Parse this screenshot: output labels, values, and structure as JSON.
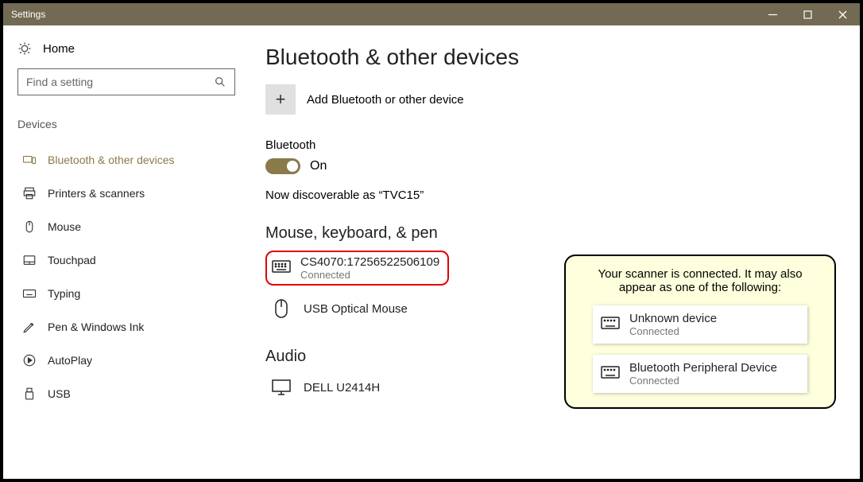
{
  "window_title": "Settings",
  "home_label": "Home",
  "search": {
    "placeholder": "Find a setting"
  },
  "category": "Devices",
  "nav": [
    {
      "label": "Bluetooth & other devices"
    },
    {
      "label": "Printers & scanners"
    },
    {
      "label": "Mouse"
    },
    {
      "label": "Touchpad"
    },
    {
      "label": "Typing"
    },
    {
      "label": "Pen & Windows Ink"
    },
    {
      "label": "AutoPlay"
    },
    {
      "label": "USB"
    }
  ],
  "page_title": "Bluetooth & other devices",
  "add_device_label": "Add Bluetooth or other device",
  "bluetooth_label": "Bluetooth",
  "toggle_state": "On",
  "discoverable": "Now discoverable as “TVC15”",
  "section_mouse": "Mouse, keyboard, & pen",
  "devices_mouse": [
    {
      "name": "CS4070:17256522506109",
      "status": "Connected"
    },
    {
      "name": "USB Optical Mouse"
    }
  ],
  "section_audio": "Audio",
  "devices_audio": [
    {
      "name": "DELL U2414H"
    }
  ],
  "callout": {
    "text": "Your scanner is connected. It may also appear as one of the following:",
    "items": [
      {
        "name": "Unknown device",
        "status": "Connected"
      },
      {
        "name": "Bluetooth Peripheral Device",
        "status": "Connected"
      }
    ]
  }
}
